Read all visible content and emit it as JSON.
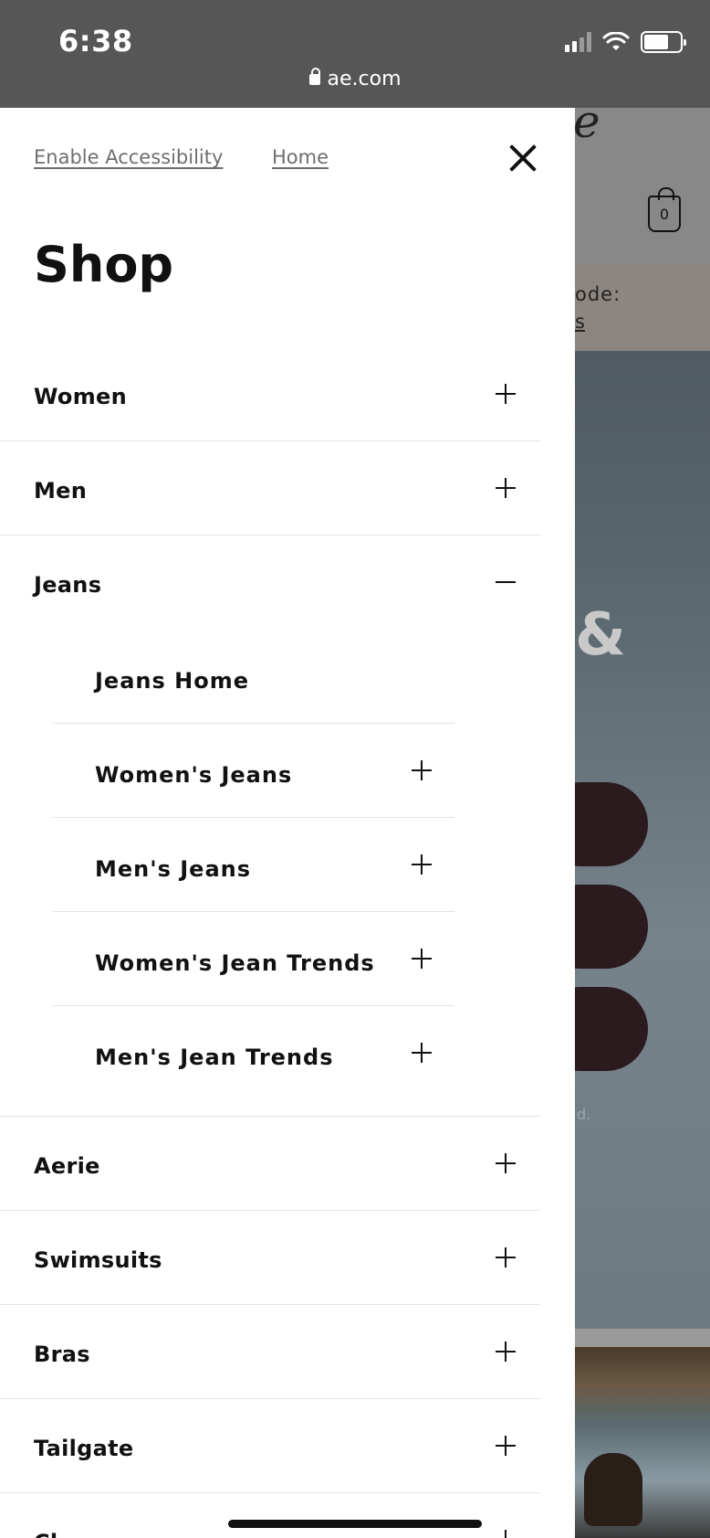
{
  "status_bar": {
    "time": "6:38",
    "url": "ae.com",
    "battery_level": 0.68
  },
  "background_page": {
    "logo_fragment": "e",
    "bag_count": "0",
    "promo_line1": "ode:",
    "promo_line2": "s",
    "hero_glyph": "&",
    "footnote_fragment": "d."
  },
  "drawer": {
    "enable_accessibility": "Enable Accessibility",
    "home_link": "Home",
    "title": "Shop",
    "categories": [
      {
        "label": "Women",
        "state": "collapsed"
      },
      {
        "label": "Men",
        "state": "collapsed"
      },
      {
        "label": "Jeans",
        "state": "expanded"
      },
      {
        "label": "Aerie",
        "state": "collapsed"
      },
      {
        "label": "Swimsuits",
        "state": "collapsed"
      },
      {
        "label": "Bras",
        "state": "collapsed"
      },
      {
        "label": "Tailgate",
        "state": "collapsed"
      },
      {
        "label": "Cl",
        "state": "collapsed"
      }
    ],
    "jeans_subitems": [
      {
        "label": "Jeans Home",
        "expandable": false
      },
      {
        "label": "Women's Jeans",
        "expandable": true
      },
      {
        "label": "Men's Jeans",
        "expandable": true
      },
      {
        "label": "Women's Jean Trends",
        "expandable": true
      },
      {
        "label": "Men's Jean Trends",
        "expandable": true
      }
    ]
  }
}
